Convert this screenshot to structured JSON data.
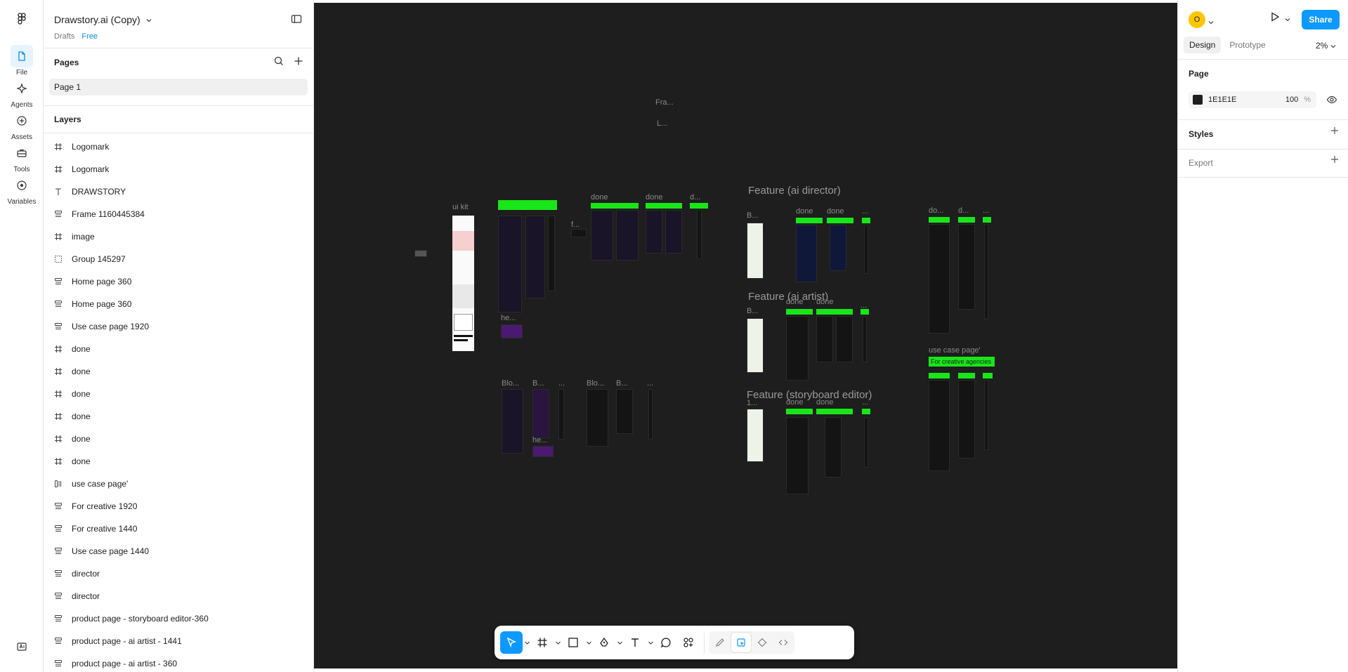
{
  "file": {
    "title": "Drawstory.ai (Copy)",
    "drafts": "Drafts",
    "plan": "Free"
  },
  "rail": [
    {
      "id": "file",
      "label": "File",
      "icon": "file-icon"
    },
    {
      "id": "agents",
      "label": "Agents",
      "icon": "agents-icon"
    },
    {
      "id": "assets",
      "label": "Assets",
      "icon": "assets-icon"
    },
    {
      "id": "tools",
      "label": "Tools",
      "icon": "tools-icon"
    },
    {
      "id": "variables",
      "label": "Variables",
      "icon": "variables-icon"
    }
  ],
  "pages": {
    "heading": "Pages",
    "current": "Page 1"
  },
  "layers": {
    "heading": "Layers",
    "items": [
      {
        "name": "Logomark",
        "type": "frame"
      },
      {
        "name": "Logomark",
        "type": "frame"
      },
      {
        "name": "DRAWSTORY",
        "type": "text"
      },
      {
        "name": "Frame 1160445384",
        "type": "autolayout"
      },
      {
        "name": "image",
        "type": "frame"
      },
      {
        "name": "Group 145297",
        "type": "group"
      },
      {
        "name": "Home page 360",
        "type": "autolayout"
      },
      {
        "name": "Home page 360",
        "type": "autolayout"
      },
      {
        "name": "Use case page 1920",
        "type": "autolayout"
      },
      {
        "name": "done",
        "type": "frame"
      },
      {
        "name": "done",
        "type": "frame"
      },
      {
        "name": "done",
        "type": "frame"
      },
      {
        "name": "done",
        "type": "frame"
      },
      {
        "name": "done",
        "type": "frame"
      },
      {
        "name": "done",
        "type": "frame"
      },
      {
        "name": "use case page'",
        "type": "autolayout-h"
      },
      {
        "name": "For creative  1920",
        "type": "autolayout"
      },
      {
        "name": "For creative  1440",
        "type": "autolayout"
      },
      {
        "name": "Use case page 1440",
        "type": "autolayout"
      },
      {
        "name": "director",
        "type": "autolayout"
      },
      {
        "name": "director",
        "type": "autolayout"
      },
      {
        "name": "product page - storyboard editor-360",
        "type": "autolayout"
      },
      {
        "name": "product page - ai artist - 1441",
        "type": "autolayout"
      },
      {
        "name": "product page - ai artist - 360",
        "type": "autolayout"
      }
    ]
  },
  "canvas": {
    "labels": {
      "fra": "Fra...",
      "l": "L...",
      "ui_kit": "ui kit",
      "done1": "done",
      "done2": "done",
      "d1": "d...",
      "f": "f...",
      "he1": "he...",
      "blo1": "Blo...",
      "b1": "B...",
      "dots1": "...",
      "blo2": "Blo...",
      "b2": "B...",
      "dots2": "...",
      "he2": "he...",
      "feature_director": "Feature (ai director)",
      "b3": "B...",
      "done3": "done",
      "done4": "done",
      "dots3": "...",
      "feature_artist": "Feature (ai artist)",
      "b4": "B...",
      "done5": "done",
      "done6": "done",
      "dots4": "...",
      "feature_storyboard": "Feature (storyboard editor)",
      "one": "1...",
      "done7": "done",
      "done8": "done",
      "dots5": "...",
      "do1": "do...",
      "d2": "d...",
      "dots6": "...",
      "use_case": "use case page'",
      "creative_agencies": "For creative agencies"
    }
  },
  "toolbar": {
    "tools": [
      {
        "id": "move",
        "icon": "move-cursor-icon",
        "active": true
      },
      {
        "id": "frame",
        "icon": "frame-hash-icon"
      },
      {
        "id": "shape",
        "icon": "rectangle-icon"
      },
      {
        "id": "pen",
        "icon": "pen-icon"
      },
      {
        "id": "text",
        "icon": "text-icon"
      },
      {
        "id": "comment",
        "icon": "comment-icon"
      },
      {
        "id": "actions",
        "icon": "actions-icon"
      }
    ],
    "modes": [
      "draw-icon",
      "design-icon",
      "dev-components-icon",
      "code-icon"
    ]
  },
  "help": "?",
  "right": {
    "avatar_initial": "O",
    "share": "Share",
    "tabs": [
      "Design",
      "Prototype"
    ],
    "active_tab": "Design",
    "zoom": "2%",
    "page": {
      "heading": "Page",
      "bg_hex": "1E1E1E",
      "opacity": "100",
      "opacity_unit": "%"
    },
    "styles": "Styles",
    "export": "Export"
  },
  "colors": {
    "accent": "#0d99ff",
    "canvas": "#1e1e1e",
    "green_tag": "#19e619",
    "avatar": "#ffc700"
  }
}
